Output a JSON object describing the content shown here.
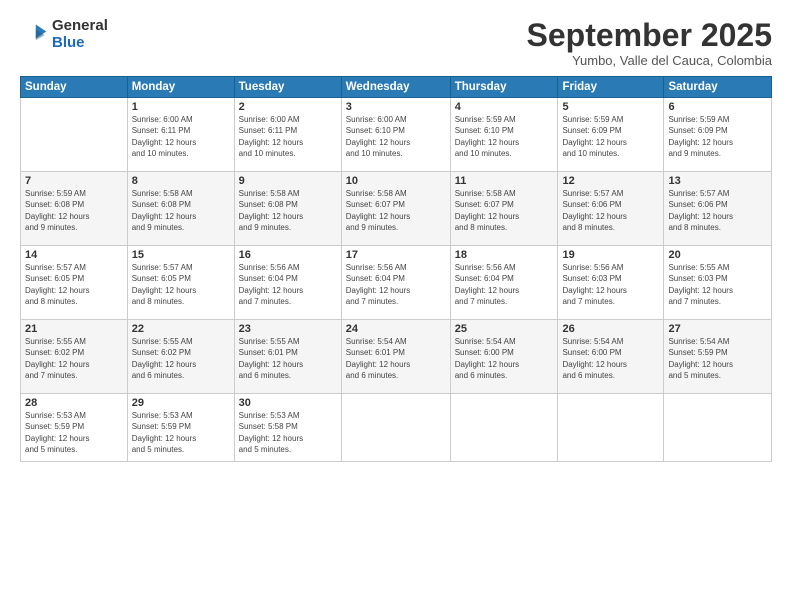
{
  "header": {
    "logo_general": "General",
    "logo_blue": "Blue",
    "month_title": "September 2025",
    "location": "Yumbo, Valle del Cauca, Colombia"
  },
  "weekdays": [
    "Sunday",
    "Monday",
    "Tuesday",
    "Wednesday",
    "Thursday",
    "Friday",
    "Saturday"
  ],
  "weeks": [
    [
      {
        "day": "",
        "text": ""
      },
      {
        "day": "1",
        "text": "Sunrise: 6:00 AM\nSunset: 6:11 PM\nDaylight: 12 hours\nand 10 minutes."
      },
      {
        "day": "2",
        "text": "Sunrise: 6:00 AM\nSunset: 6:11 PM\nDaylight: 12 hours\nand 10 minutes."
      },
      {
        "day": "3",
        "text": "Sunrise: 6:00 AM\nSunset: 6:10 PM\nDaylight: 12 hours\nand 10 minutes."
      },
      {
        "day": "4",
        "text": "Sunrise: 5:59 AM\nSunset: 6:10 PM\nDaylight: 12 hours\nand 10 minutes."
      },
      {
        "day": "5",
        "text": "Sunrise: 5:59 AM\nSunset: 6:09 PM\nDaylight: 12 hours\nand 10 minutes."
      },
      {
        "day": "6",
        "text": "Sunrise: 5:59 AM\nSunset: 6:09 PM\nDaylight: 12 hours\nand 9 minutes."
      }
    ],
    [
      {
        "day": "7",
        "text": "Sunrise: 5:59 AM\nSunset: 6:08 PM\nDaylight: 12 hours\nand 9 minutes."
      },
      {
        "day": "8",
        "text": "Sunrise: 5:58 AM\nSunset: 6:08 PM\nDaylight: 12 hours\nand 9 minutes."
      },
      {
        "day": "9",
        "text": "Sunrise: 5:58 AM\nSunset: 6:08 PM\nDaylight: 12 hours\nand 9 minutes."
      },
      {
        "day": "10",
        "text": "Sunrise: 5:58 AM\nSunset: 6:07 PM\nDaylight: 12 hours\nand 9 minutes."
      },
      {
        "day": "11",
        "text": "Sunrise: 5:58 AM\nSunset: 6:07 PM\nDaylight: 12 hours\nand 8 minutes."
      },
      {
        "day": "12",
        "text": "Sunrise: 5:57 AM\nSunset: 6:06 PM\nDaylight: 12 hours\nand 8 minutes."
      },
      {
        "day": "13",
        "text": "Sunrise: 5:57 AM\nSunset: 6:06 PM\nDaylight: 12 hours\nand 8 minutes."
      }
    ],
    [
      {
        "day": "14",
        "text": "Sunrise: 5:57 AM\nSunset: 6:05 PM\nDaylight: 12 hours\nand 8 minutes."
      },
      {
        "day": "15",
        "text": "Sunrise: 5:57 AM\nSunset: 6:05 PM\nDaylight: 12 hours\nand 8 minutes."
      },
      {
        "day": "16",
        "text": "Sunrise: 5:56 AM\nSunset: 6:04 PM\nDaylight: 12 hours\nand 7 minutes."
      },
      {
        "day": "17",
        "text": "Sunrise: 5:56 AM\nSunset: 6:04 PM\nDaylight: 12 hours\nand 7 minutes."
      },
      {
        "day": "18",
        "text": "Sunrise: 5:56 AM\nSunset: 6:04 PM\nDaylight: 12 hours\nand 7 minutes."
      },
      {
        "day": "19",
        "text": "Sunrise: 5:56 AM\nSunset: 6:03 PM\nDaylight: 12 hours\nand 7 minutes."
      },
      {
        "day": "20",
        "text": "Sunrise: 5:55 AM\nSunset: 6:03 PM\nDaylight: 12 hours\nand 7 minutes."
      }
    ],
    [
      {
        "day": "21",
        "text": "Sunrise: 5:55 AM\nSunset: 6:02 PM\nDaylight: 12 hours\nand 7 minutes."
      },
      {
        "day": "22",
        "text": "Sunrise: 5:55 AM\nSunset: 6:02 PM\nDaylight: 12 hours\nand 6 minutes."
      },
      {
        "day": "23",
        "text": "Sunrise: 5:55 AM\nSunset: 6:01 PM\nDaylight: 12 hours\nand 6 minutes."
      },
      {
        "day": "24",
        "text": "Sunrise: 5:54 AM\nSunset: 6:01 PM\nDaylight: 12 hours\nand 6 minutes."
      },
      {
        "day": "25",
        "text": "Sunrise: 5:54 AM\nSunset: 6:00 PM\nDaylight: 12 hours\nand 6 minutes."
      },
      {
        "day": "26",
        "text": "Sunrise: 5:54 AM\nSunset: 6:00 PM\nDaylight: 12 hours\nand 6 minutes."
      },
      {
        "day": "27",
        "text": "Sunrise: 5:54 AM\nSunset: 5:59 PM\nDaylight: 12 hours\nand 5 minutes."
      }
    ],
    [
      {
        "day": "28",
        "text": "Sunrise: 5:53 AM\nSunset: 5:59 PM\nDaylight: 12 hours\nand 5 minutes."
      },
      {
        "day": "29",
        "text": "Sunrise: 5:53 AM\nSunset: 5:59 PM\nDaylight: 12 hours\nand 5 minutes."
      },
      {
        "day": "30",
        "text": "Sunrise: 5:53 AM\nSunset: 5:58 PM\nDaylight: 12 hours\nand 5 minutes."
      },
      {
        "day": "",
        "text": ""
      },
      {
        "day": "",
        "text": ""
      },
      {
        "day": "",
        "text": ""
      },
      {
        "day": "",
        "text": ""
      }
    ]
  ]
}
